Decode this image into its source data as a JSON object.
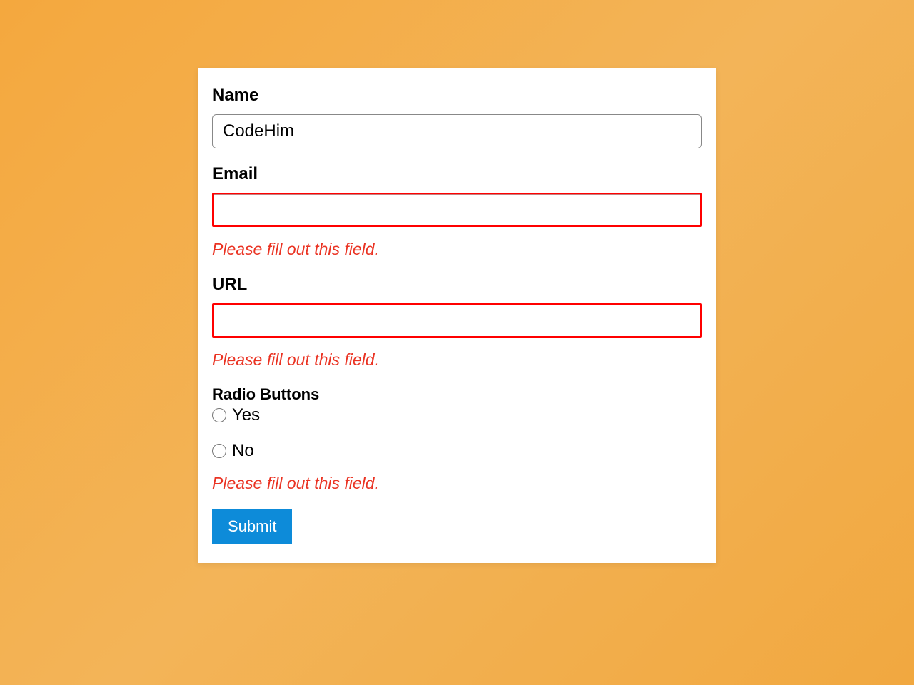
{
  "form": {
    "name": {
      "label": "Name",
      "value": "CodeHim"
    },
    "email": {
      "label": "Email",
      "value": "",
      "error": "Please fill out this field."
    },
    "url": {
      "label": "URL",
      "value": "",
      "error": "Please fill out this field."
    },
    "radio": {
      "label": "Radio Buttons",
      "options": {
        "yes": "Yes",
        "no": "No"
      },
      "error": "Please fill out this field."
    },
    "submit_label": "Submit"
  }
}
